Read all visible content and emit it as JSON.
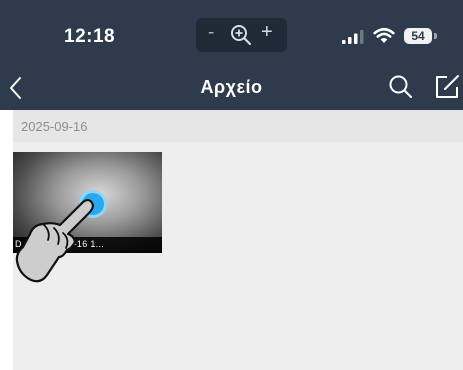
{
  "status_bar": {
    "time": "12:18",
    "zoom_controls": {
      "minus": "-",
      "plus": "+"
    },
    "battery_level": "54"
  },
  "nav": {
    "title": "Αρχείο",
    "icons": [
      "back-chevron-icon",
      "search-icon",
      "edit-icon"
    ]
  },
  "content": {
    "date_header": "2025-09-16",
    "items": [
      {
        "caption": "D            09(2025-09-16 1..."
      }
    ]
  },
  "colors": {
    "header_bg": "#2d3b4c",
    "content_bg": "#eeeeee",
    "play_accent": "#2aa8ef"
  }
}
